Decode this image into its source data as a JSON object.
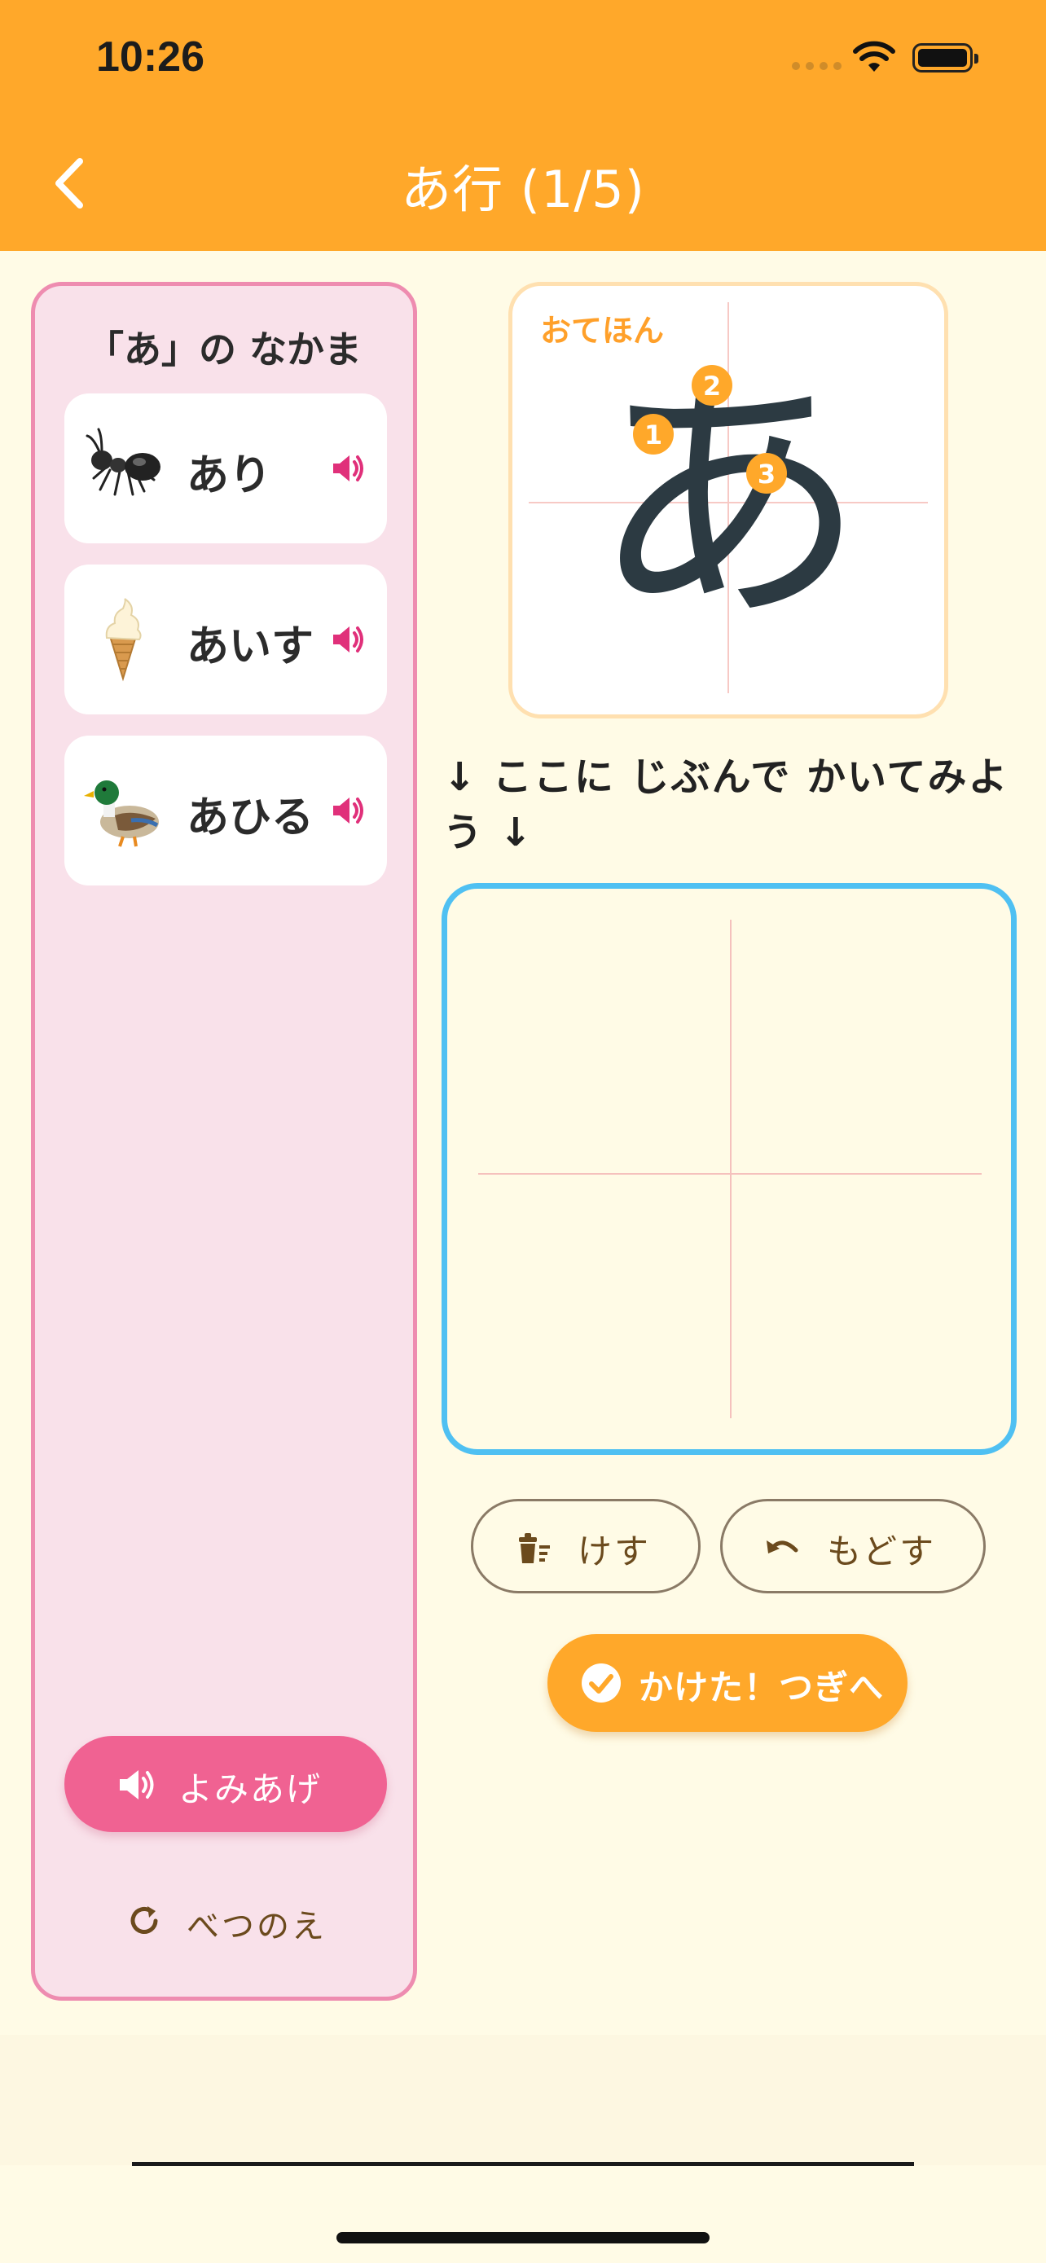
{
  "status_bar": {
    "time": "10:26"
  },
  "nav": {
    "title": "あ行 (1/5)"
  },
  "left_panel": {
    "title": "「あ」の なかま",
    "words": [
      {
        "label": "あり",
        "emoji": "ant-icon"
      },
      {
        "label": "あいす",
        "emoji": "ice-cream-icon"
      },
      {
        "label": "あひる",
        "emoji": "duck-icon"
      }
    ],
    "read_aloud_label": "よみあげ",
    "other_picture_label": "べつのえ"
  },
  "model": {
    "label": "おてほん",
    "character": "あ",
    "stroke_numbers": [
      "1",
      "2",
      "3"
    ]
  },
  "instruction": "↓ ここに じぶんで かいてみよう ↓",
  "buttons": {
    "erase": "けす",
    "undo": "もどす",
    "next": "かけた！つぎへ"
  },
  "colors": {
    "accent_orange": "#ffa82a",
    "pink": "#f06292",
    "pad_border": "#4fc0f2",
    "background": "#fffbe6"
  }
}
